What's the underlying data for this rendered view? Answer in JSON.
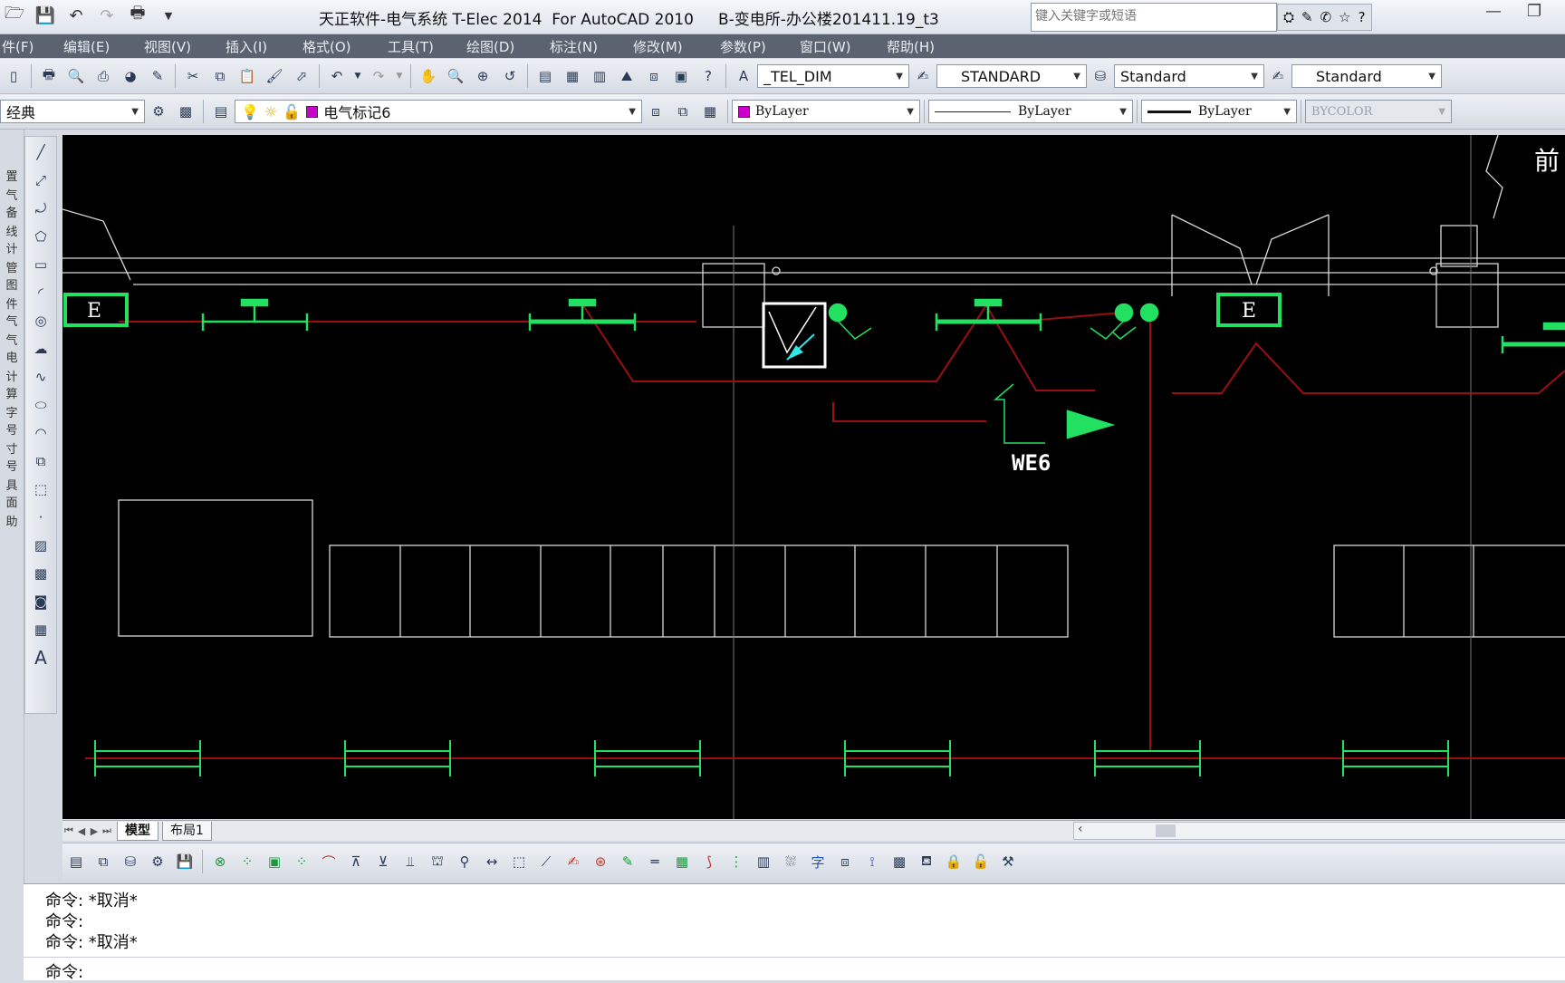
{
  "app": {
    "title": "天正软件-电气系统 T-Elec 2014  For AutoCAD 2010     B-变电所-办公楼201411.19_t3",
    "search_placeholder": "键入关键字或短语"
  },
  "menu": [
    "件(F)",
    "编辑(E)",
    "视图(V)",
    "插入(I)",
    "格式(O)",
    "工具(T)",
    "绘图(D)",
    "标注(N)",
    "修改(M)",
    "参数(P)",
    "窗口(W)",
    "帮助(H)"
  ],
  "toolbar1": {
    "text_style": "_TEL_DIM",
    "dim_style": "STANDARD",
    "table_style": "Standard",
    "multileader_style": "Standard"
  },
  "toolbar2": {
    "workspace": "经典",
    "layer": "电气标记6",
    "color": "ByLayer",
    "linetype": "ByLayer",
    "lineweight": "ByLayer",
    "plotstyle": "BYCOLOR"
  },
  "colors": {
    "layer_color": "#cc00cc",
    "cad_green": "#22e060",
    "cad_red": "#9b0f14",
    "cad_white": "#ffffff",
    "canvas_bg": "#000000"
  },
  "drawing": {
    "corner_text": "前",
    "panel_label_1": "E",
    "panel_label_2": "E",
    "circuit_label": "WE6"
  },
  "tabs": {
    "model": "模型",
    "layout1": "布局1"
  },
  "left_strip_chars": [
    "置",
    "气",
    "备",
    "线",
    "计",
    "管",
    "图",
    "件",
    "气",
    "气",
    "电",
    "计",
    "算",
    "字",
    "号",
    "寸",
    "号",
    "具",
    "面",
    "助"
  ],
  "command": {
    "lines": [
      "命令: *取消*",
      "命令:",
      "命令: *取消*"
    ],
    "prompt": "命令:"
  }
}
